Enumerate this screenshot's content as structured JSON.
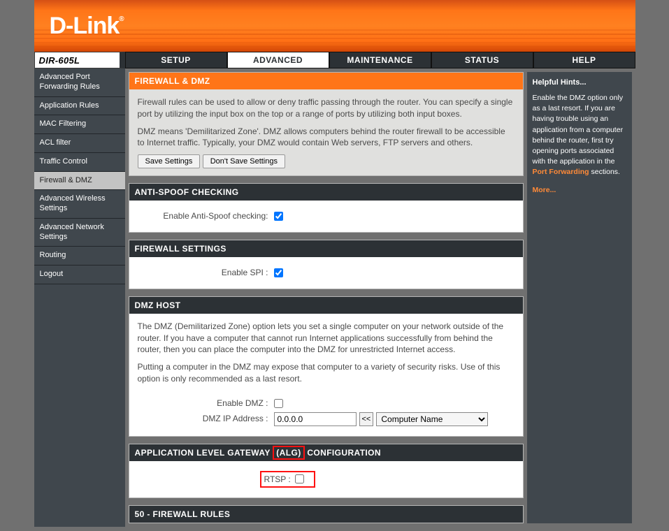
{
  "brand": "D-Link",
  "model": "DIR-605L",
  "top_tabs": {
    "setup": "SETUP",
    "advanced": "ADVANCED",
    "maintenance": "MAINTENANCE",
    "status": "STATUS",
    "help": "HELP"
  },
  "sidebar": {
    "items": [
      "Advanced Port Forwarding Rules",
      "Application Rules",
      "MAC Filtering",
      "ACL filter",
      "Traffic Control",
      "Firewall & DMZ",
      "Advanced Wireless Settings",
      "Advanced Network Settings",
      "Routing",
      "Logout"
    ],
    "active_index": 5
  },
  "intro": {
    "title": "FIREWALL & DMZ",
    "p1": "Firewall rules can be used to allow or deny traffic passing through the router. You can specify a single port by utilizing the input box on the top or a range of ports by utilizing both input boxes.",
    "p2": "DMZ means 'Demilitarized Zone'. DMZ allows computers behind the router firewall to be accessible to Internet traffic. Typically, your DMZ would contain Web servers, FTP servers and others.",
    "save_btn": "Save Settings",
    "dont_save_btn": "Don't Save Settings"
  },
  "anti_spoof": {
    "title": "ANTI-SPOOF CHECKING",
    "label": "Enable Anti-Spoof checking:"
  },
  "firewall_settings": {
    "title": "FIREWALL SETTINGS",
    "label": "Enable SPI :"
  },
  "dmz": {
    "title": "DMZ HOST",
    "p1": "The DMZ (Demilitarized Zone) option lets you set a single computer on your network outside of the router. If you have a computer that cannot run Internet applications successfully from behind the router, then you can place the computer into the DMZ for unrestricted Internet access.",
    "p2": "Putting a computer in the DMZ may expose that computer to a variety of security risks. Use of this option is only recommended as a last resort.",
    "enable_label": "Enable DMZ :",
    "ip_label": "DMZ IP Address  :",
    "ip_value": "0.0.0.0",
    "copy_btn": "<<",
    "computer_select": "Computer Name"
  },
  "alg": {
    "title_pre": "APPLICATION LEVEL GATEWAY ",
    "title_highlight": "(ALG)",
    "title_post": " CONFIGURATION",
    "rtsp_label": "RTSP :"
  },
  "firewall_rules": {
    "title": "50 - FIREWALL RULES"
  },
  "hints": {
    "title": "Helpful Hints...",
    "body_pre": "Enable the DMZ option only as a last resort. If you are having trouble using an application from a computer behind the router, first try opening ports associated with the application in the ",
    "link1": "Port Forwarding",
    "body_post": " sections.",
    "more": "More..."
  }
}
